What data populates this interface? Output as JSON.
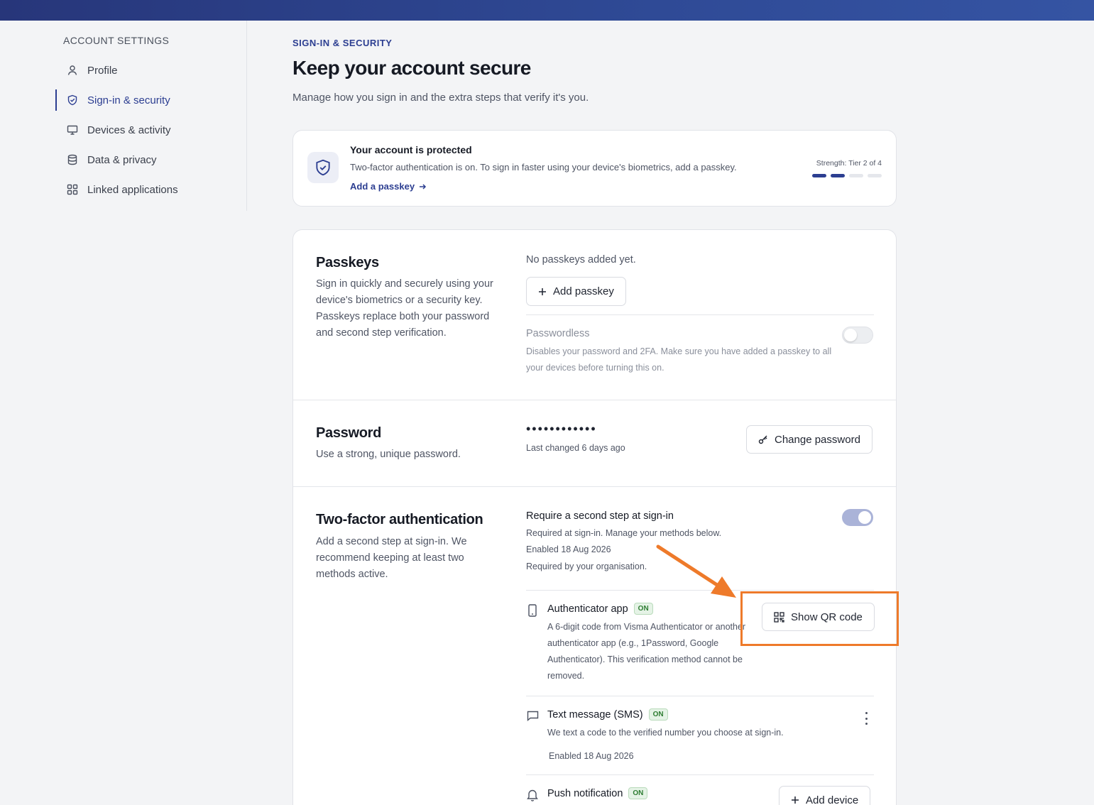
{
  "sidebar": {
    "heading": "ACCOUNT SETTINGS",
    "items": [
      {
        "label": "Profile",
        "icon": "user-icon"
      },
      {
        "label": "Sign-in & security",
        "icon": "shield-icon",
        "active": true
      },
      {
        "label": "Devices & activity",
        "icon": "monitor-icon"
      },
      {
        "label": "Data & privacy",
        "icon": "database-icon"
      },
      {
        "label": "Linked applications",
        "icon": "grid-icon"
      }
    ]
  },
  "header": {
    "eyebrow": "SIGN-IN & SECURITY",
    "title": "Keep your account secure",
    "subtitle": "Manage how you sign in and the extra steps that verify it's you."
  },
  "status": {
    "title": "Your account is protected",
    "description": "Two-factor authentication is on. To sign in faster using your device's biometrics, add a passkey.",
    "link": "Add a passkey",
    "strength_label": "Strength: Tier 2 of 4",
    "strength_level": 2,
    "strength_max": 4
  },
  "passkeys": {
    "title": "Passkeys",
    "description": "Sign in quickly and securely using your device's biometrics or a security key. Passkeys replace both your password and second step verification.",
    "empty_text": "No passkeys added yet.",
    "add_button": "Add passkey",
    "passwordless_title": "Passwordless",
    "passwordless_desc": "Disables your password and 2FA. Make sure you have added a passkey to all your devices before turning this on.",
    "passwordless_enabled": false
  },
  "password": {
    "title": "Password",
    "description": "Use a strong, unique password.",
    "masked": "••••••••••••",
    "last_changed": "Last changed 6 days ago",
    "change_button": "Change password"
  },
  "two_factor": {
    "title": "Two-factor authentication",
    "description": "Add a second step at sign-in. We recommend keeping at least two methods active.",
    "require_title": "Require a second step at sign-in",
    "require_lines": [
      "Required at sign-in. Manage your methods below.",
      "Enabled 18 Aug 2026",
      "Required by your organisation."
    ],
    "require_enabled": true,
    "methods": [
      {
        "title": "Authenticator app",
        "badge": "ON",
        "description": "A 6-digit code from Visma Authenticator or another authenticator app (e.g., 1Password, Google Authenticator). This verification method cannot be removed.",
        "action": "Show QR code"
      },
      {
        "title": "Text message (SMS)",
        "badge": "ON",
        "description": "We text a code to the verified number you choose at sign-in.",
        "enabled_date": "Enabled 18 Aug 2026"
      },
      {
        "title": "Push notification",
        "badge": "ON",
        "action": "Add device"
      }
    ]
  },
  "colors": {
    "accent": "#2c3e91",
    "annotation": "#ee7a2a",
    "badge_green": "#2e7d32"
  }
}
